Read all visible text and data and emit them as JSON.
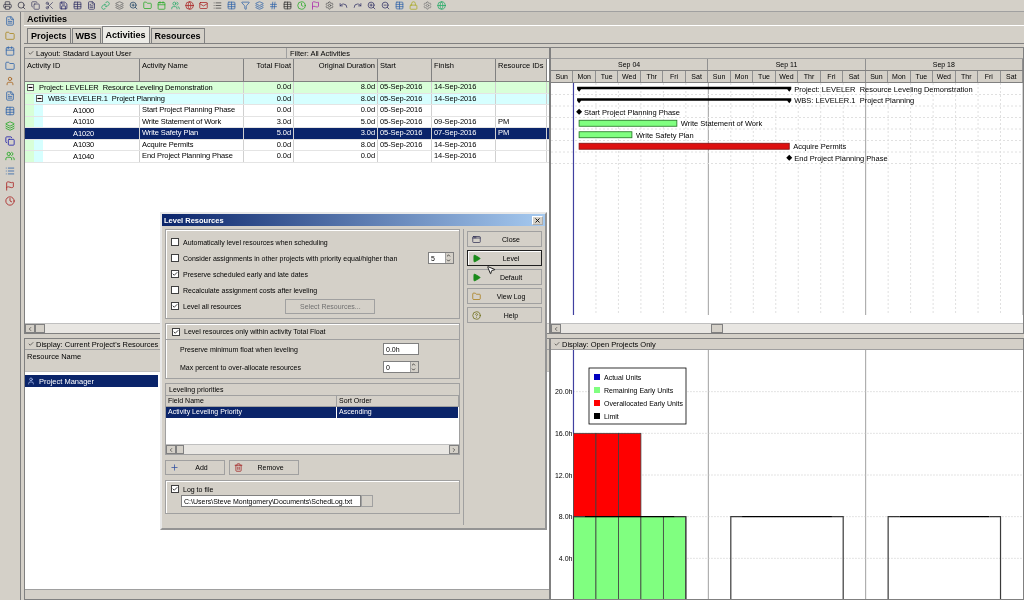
{
  "window": {
    "title": "Activities"
  },
  "tabs": [
    {
      "label": "Projects",
      "selected": false
    },
    {
      "label": "WBS",
      "selected": false
    },
    {
      "label": "Activities",
      "selected": true
    },
    {
      "label": "Resources",
      "selected": false
    }
  ],
  "activities": {
    "layout": "Layout: Stadard Layout User",
    "filter": "Filter: All Activities",
    "columns": [
      "Activity ID",
      "Activity Name",
      "Total Float",
      "Original Duration",
      "Start",
      "Finish",
      "Resource IDs"
    ],
    "rows": [
      {
        "kind": "project",
        "label": "Project: LEVELER  Resource Leveling Demonstration",
        "expanded": true,
        "total_float": "0.0d",
        "original_duration": "8.0d",
        "start": "05-Sep-2016",
        "finish": "14-Sep-2016",
        "children": [
          {
            "kind": "wbs",
            "label": "WBS: LEVELER.1  Project Planning",
            "expanded": true,
            "total_float": "0.0d",
            "original_duration": "8.0d",
            "start": "05-Sep-2016",
            "finish": "14-Sep-2016",
            "children": [
              {
                "kind": "activity",
                "id": "A1000",
                "name": "Start Project Planning Phase",
                "total_float": "0.0d",
                "original_duration": "0.0d",
                "start": "05-Sep-2016",
                "selected": false
              },
              {
                "kind": "activity",
                "id": "A1010",
                "name": "Write Statement of Work",
                "total_float": "3.0d",
                "original_duration": "5.0d",
                "start": "05-Sep-2016",
                "finish": "09-Sep-2016",
                "resource_ids": "PM",
                "selected": false
              },
              {
                "kind": "activity",
                "id": "A1020",
                "name": "Write Safety Plan",
                "total_float": "5.0d",
                "original_duration": "3.0d",
                "start": "05-Sep-2016",
                "finish": "07-Sep-2016",
                "resource_ids": "PM",
                "selected": true
              },
              {
                "kind": "activity",
                "id": "A1030",
                "name": "Acquire Permits",
                "total_float": "0.0d",
                "original_duration": "8.0d",
                "start": "05-Sep-2016",
                "finish": "14-Sep-2016",
                "selected": false
              },
              {
                "kind": "activity",
                "id": "A1040",
                "name": "End Project Planning Phase",
                "total_float": "0.0d",
                "original_duration": "0.0d",
                "finish": "14-Sep-2016",
                "selected": false
              }
            ]
          }
        ]
      }
    ]
  },
  "gantt": {
    "weeks": [
      "Sep 04",
      "Sep 11",
      "Sep 18"
    ],
    "days": [
      "Sun",
      "Mon",
      "Tue",
      "Wed",
      "Thr",
      "Fri",
      "Sat",
      "Sun",
      "Mon",
      "Tue",
      "Wed",
      "Thr",
      "Fri",
      "Sat",
      "Sun",
      "Mon",
      "Tue",
      "Wed",
      "Thr",
      "Fri",
      "Sat"
    ],
    "bars": [
      {
        "kind": "summary",
        "label": "Project: LEVELER  Resource Leveling Demonstration"
      },
      {
        "kind": "summary",
        "label": "WBS: LEVELER.1  Project Planning"
      },
      {
        "kind": "milestone",
        "label": "Start Project Planning Phase"
      },
      {
        "kind": "task",
        "label": "Write Statement of Work"
      },
      {
        "kind": "task",
        "label": "Write Safety Plan"
      },
      {
        "kind": "critical",
        "label": "Acquire Permits"
      },
      {
        "kind": "milestone",
        "label": "End Project Planning Phase"
      }
    ]
  },
  "resources": {
    "display": "Display: Current Project's Resources",
    "column": "Resource Name",
    "rows": [
      {
        "name": "Project Manager",
        "selected": true
      }
    ]
  },
  "histogram": {
    "display": "Display: Open Projects Only",
    "chart_data": {
      "type": "bar",
      "stacked": true,
      "ylim": [
        0,
        24
      ],
      "grid": true,
      "legend": true,
      "yticks": [
        {
          "value": 4,
          "label": "4.0h"
        },
        {
          "value": 8,
          "label": "8.0h"
        },
        {
          "value": 12,
          "label": "12.0h"
        },
        {
          "value": 16,
          "label": "16.0h"
        },
        {
          "value": 20,
          "label": "20.0h"
        }
      ],
      "series": [
        {
          "name": "Actual Units",
          "color": "#0000c0",
          "values": [
            null,
            null,
            null,
            null,
            null,
            null,
            null,
            null,
            null,
            null,
            null,
            null,
            null,
            null,
            null,
            null,
            null,
            null,
            null,
            null
          ]
        },
        {
          "name": "Remaining Early Units",
          "color": "#80ff80",
          "values": [
            8,
            8,
            8,
            8,
            8,
            null,
            null,
            null,
            null,
            null,
            null,
            null,
            null,
            null,
            null,
            null,
            null,
            null,
            null,
            null
          ]
        },
        {
          "name": "Overallocated Early Units",
          "color": "#ff0000",
          "values": [
            8,
            8,
            8,
            null,
            null,
            null,
            null,
            null,
            null,
            null,
            null,
            null,
            null,
            null,
            null,
            null,
            null,
            null,
            null,
            null
          ]
        },
        {
          "name": "Limit",
          "color": "#000000",
          "type": "line",
          "values": [
            8,
            8,
            8,
            8,
            8,
            null,
            null,
            8,
            8,
            8,
            8,
            8,
            null,
            null,
            8,
            8,
            8,
            8,
            8,
            null
          ]
        }
      ]
    }
  },
  "dialog": {
    "title": "Level Resources",
    "options": [
      {
        "kind": "check",
        "label": "Automatically level resources when scheduling",
        "checked": false
      },
      {
        "kind": "check-spin",
        "label": "Consider assignments in other projects with priority equal/higher than",
        "checked": false,
        "value": "5"
      },
      {
        "kind": "check",
        "label": "Preserve scheduled early and late dates",
        "checked": true
      },
      {
        "kind": "check",
        "label": "Recalculate assignment costs after leveling",
        "checked": false
      },
      {
        "kind": "check-button",
        "label": "Level all resources",
        "checked": true,
        "button": "Select Resources...",
        "button_disabled": true
      }
    ],
    "float_group": {
      "label": "Level resources only within activity Total Float",
      "checked": true,
      "fields": [
        {
          "kind": "text",
          "label": "Preserve minimum float when leveling",
          "value": "0.0h"
        },
        {
          "kind": "spin",
          "label": "Max percent to over-allocate resources",
          "value": "0"
        }
      ]
    },
    "priorities": {
      "title": "Leveling priorities",
      "columns": [
        "Field Name",
        "Sort Order"
      ],
      "rows": [
        {
          "cells": [
            "Activity Leveling Priority",
            "Ascending"
          ],
          "selected": true
        }
      ],
      "buttons": [
        {
          "kind": "add",
          "label": "Add"
        },
        {
          "kind": "remove",
          "label": "Remove"
        }
      ]
    },
    "log": {
      "label": "Log to file",
      "checked": true,
      "path": "C:\\Users\\Steve Montgomery\\Documents\\SchedLog.txt"
    },
    "buttons": [
      {
        "kind": "close",
        "label": "Close",
        "selected": false
      },
      {
        "kind": "run",
        "label": "Level",
        "selected": true
      },
      {
        "kind": "run",
        "label": "Default",
        "selected": false
      },
      {
        "kind": "log",
        "label": "View Log",
        "selected": false
      },
      {
        "kind": "help",
        "label": "Help",
        "selected": false
      }
    ]
  }
}
